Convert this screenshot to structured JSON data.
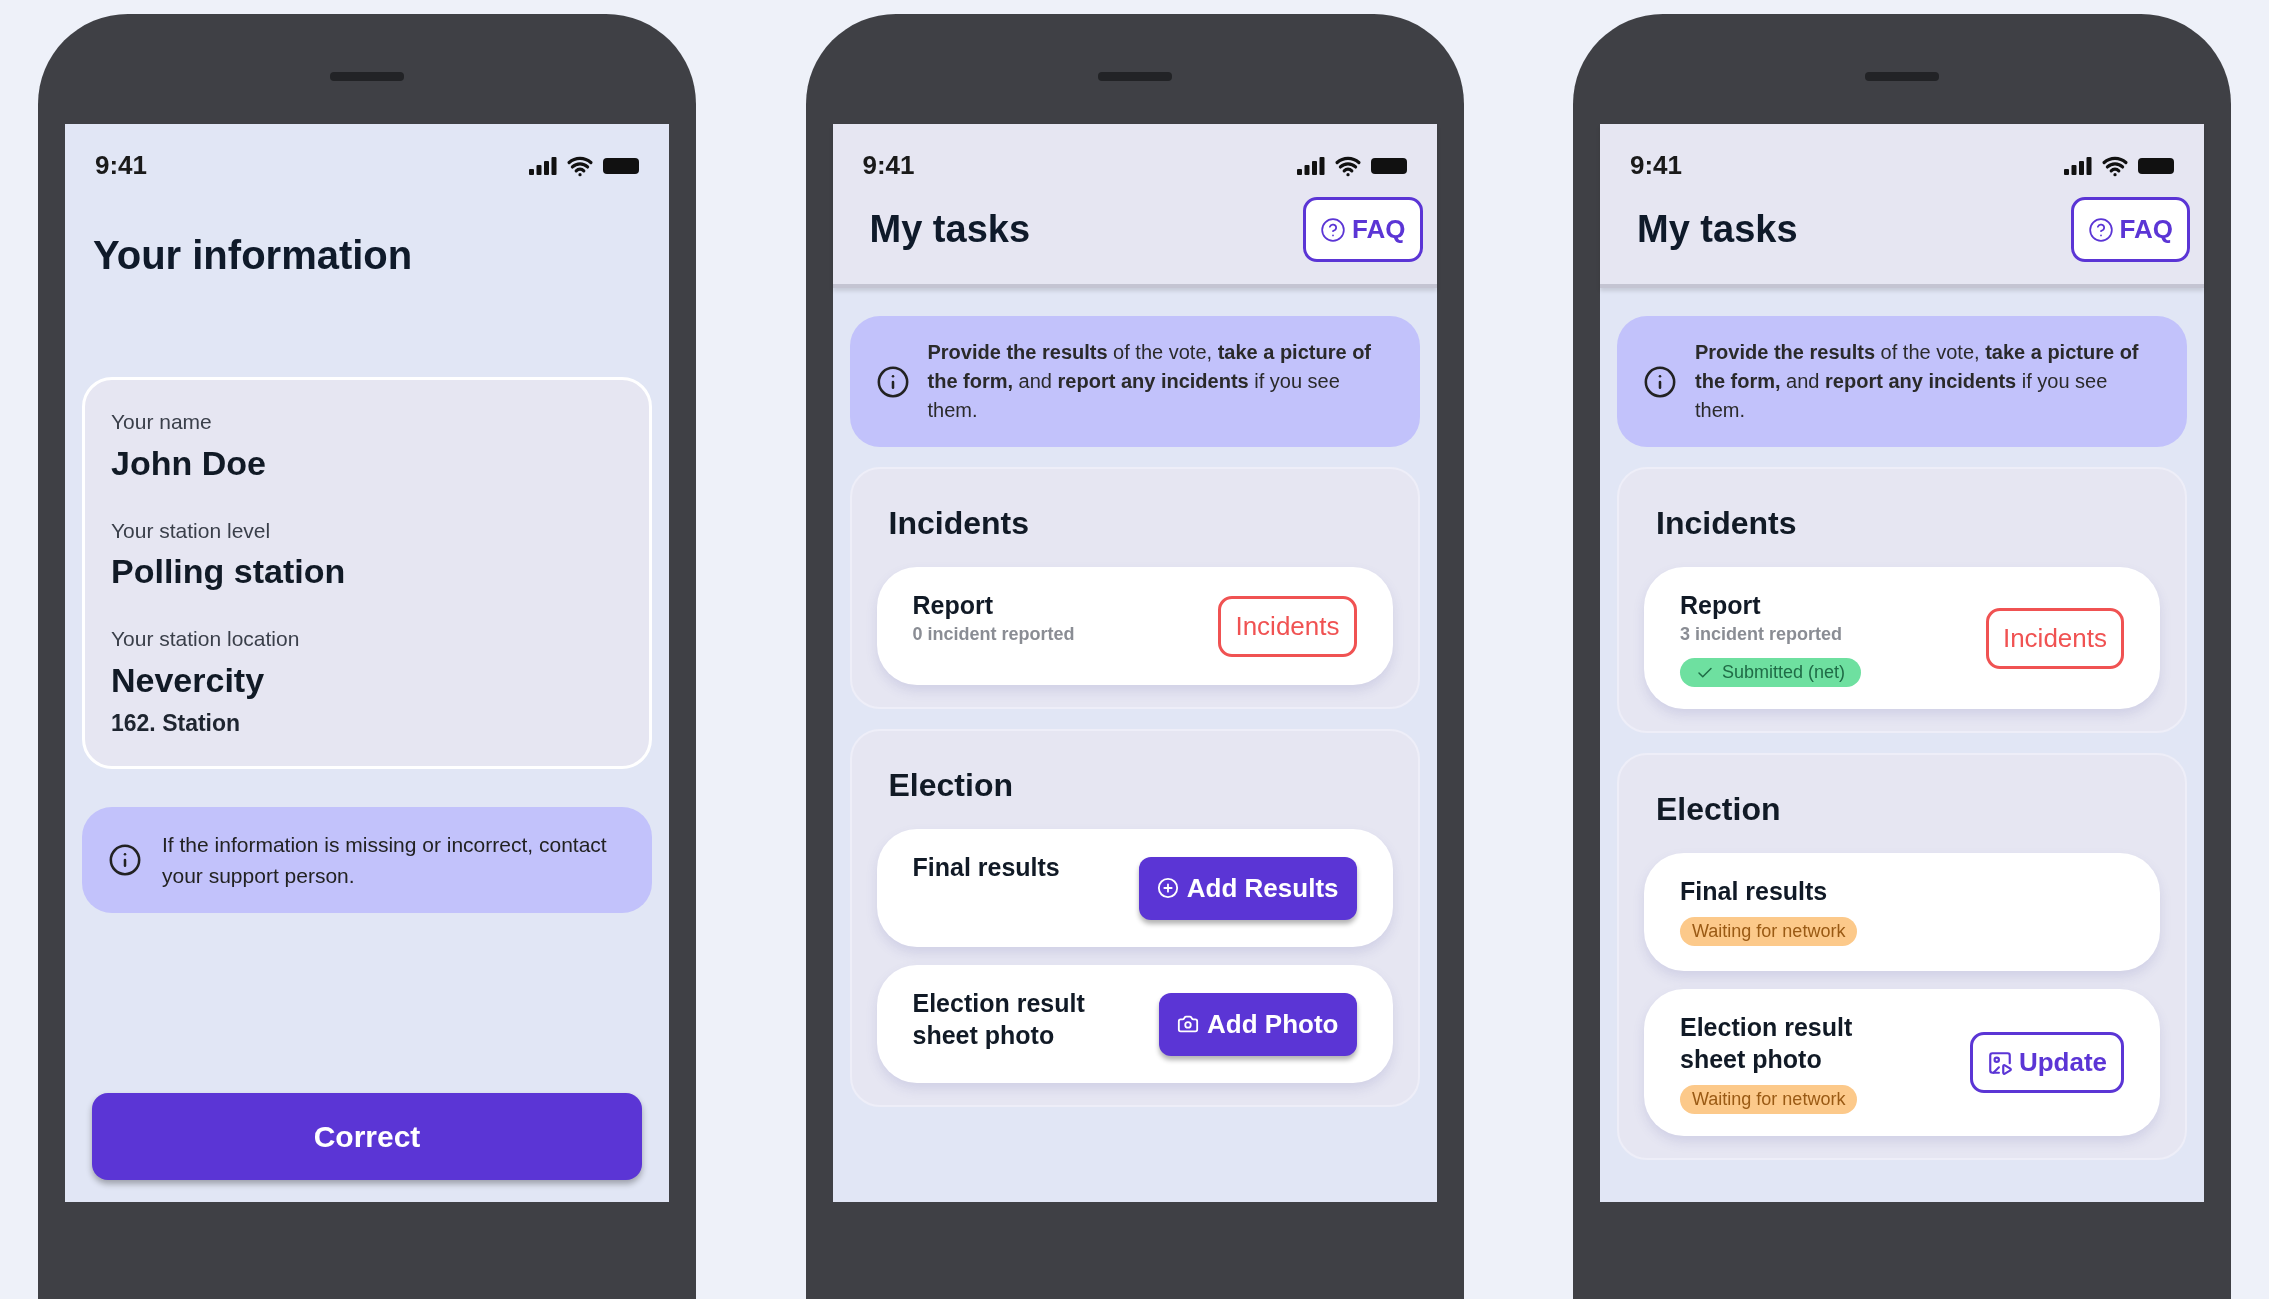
{
  "screens": [
    {
      "kind": "info",
      "time": "9:41",
      "title": "Your information",
      "fields": [
        {
          "label": "Your name",
          "value": "John Doe"
        },
        {
          "label": "Your station level",
          "value": "Polling station"
        },
        {
          "label": "Your station location",
          "value": "Nevercity",
          "sub": "162. Station"
        }
      ],
      "notice": "If the information is missing or incorrect, contact your support person.",
      "button": "Correct"
    },
    {
      "kind": "tasks",
      "time": "9:41",
      "title": "My tasks",
      "faq": "FAQ",
      "notice": "**Provide the results** of the vote, **take a picture of the form,** and **report any incidents** if you see them.",
      "sections": [
        {
          "title": "Incidents",
          "items": [
            {
              "title": "Report",
              "subtitle": "0 incident reported",
              "action": {
                "kind": "report",
                "label": "Incidents"
              }
            }
          ]
        },
        {
          "title": "Election",
          "items": [
            {
              "title": "Final results",
              "action": {
                "kind": "add",
                "label": "Add Results"
              }
            },
            {
              "title": "Election result sheet photo",
              "action": {
                "kind": "photo",
                "label": "Add Photo"
              }
            }
          ]
        }
      ]
    },
    {
      "kind": "tasks",
      "time": "9:41",
      "title": "My tasks",
      "faq": "FAQ",
      "notice": "**Provide the results** of the vote, **take a picture of the form,** and **report any incidents** if you see them.",
      "sections": [
        {
          "title": "Incidents",
          "items": [
            {
              "title": "Report",
              "subtitle": "3 incident reported",
              "badge": {
                "kind": "success",
                "label": "Submitted (net)"
              },
              "action": {
                "kind": "report",
                "label": "Incidents"
              }
            }
          ]
        },
        {
          "title": "Election",
          "items": [
            {
              "title": "Final results",
              "badge": {
                "kind": "warning",
                "label": "Waiting for network"
              }
            },
            {
              "title": "Election result sheet photo",
              "badge": {
                "kind": "warning",
                "label": "Waiting for network"
              },
              "action": {
                "kind": "update",
                "label": "Update"
              }
            }
          ]
        }
      ]
    }
  ]
}
